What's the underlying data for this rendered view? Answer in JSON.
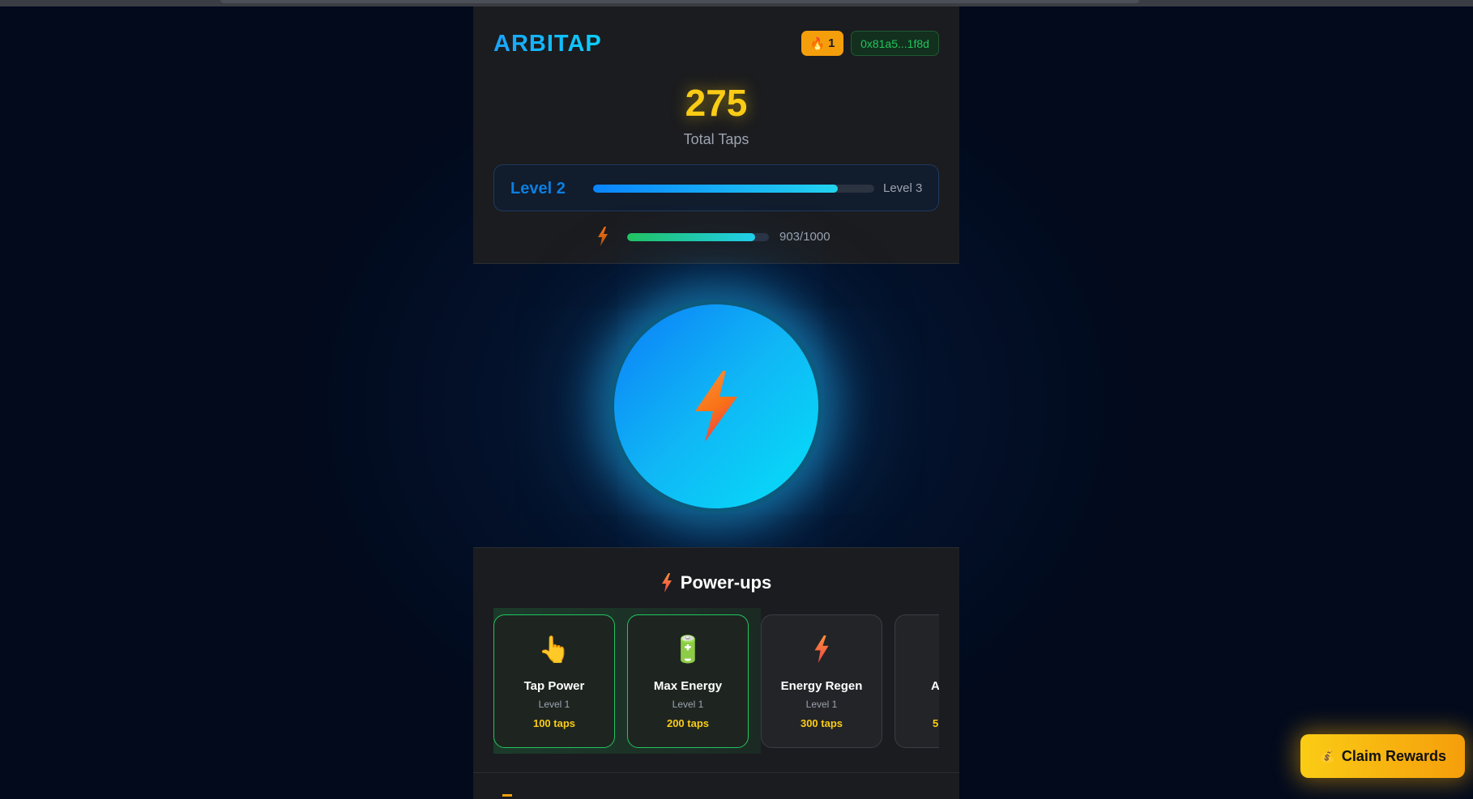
{
  "header": {
    "logo": "ARBITAP",
    "streak": {
      "icon": "fire-icon",
      "glyph": "🔥",
      "count": "1"
    },
    "wallet": "0x81a5...1f8d"
  },
  "stats": {
    "total_taps": "275",
    "total_taps_label": "Total Taps"
  },
  "level": {
    "current": "Level 2",
    "next": "Level 3",
    "progress": 0.87
  },
  "energy": {
    "icon": "lightning-icon",
    "text": "903/1000",
    "current": 903,
    "max": 1000
  },
  "tap_button": {
    "icon": "lightning-icon"
  },
  "powerups": {
    "title": "Power-ups",
    "title_icon": "lightning-icon",
    "cards": [
      {
        "icon": "pointing-hand-icon",
        "glyph": "👆",
        "name": "Tap Power",
        "level": "Level 1",
        "cost": "100 taps",
        "affordable": true
      },
      {
        "icon": "battery-icon",
        "glyph": "🔋",
        "name": "Max Energy",
        "level": "Level 1",
        "cost": "200 taps",
        "affordable": true
      },
      {
        "icon": "lightning-icon",
        "glyph": "⚡",
        "name": "Energy Regen",
        "level": "Level 1",
        "cost": "300 taps",
        "affordable": false
      },
      {
        "icon": "unknown-icon",
        "glyph": "",
        "name": "A",
        "level": "",
        "cost": "5",
        "affordable": false
      }
    ]
  },
  "claim": {
    "icon": "money-bag-icon",
    "glyph": "💰",
    "label": "Claim Rewards"
  },
  "colors": {
    "accent_blue": "#0b7ef8",
    "accent_cyan": "#05e0f8",
    "gold": "#facc15",
    "orange": "#f59e0b",
    "green": "#22c55e",
    "panel": "#1b1c1f",
    "background": "#020a1c"
  }
}
